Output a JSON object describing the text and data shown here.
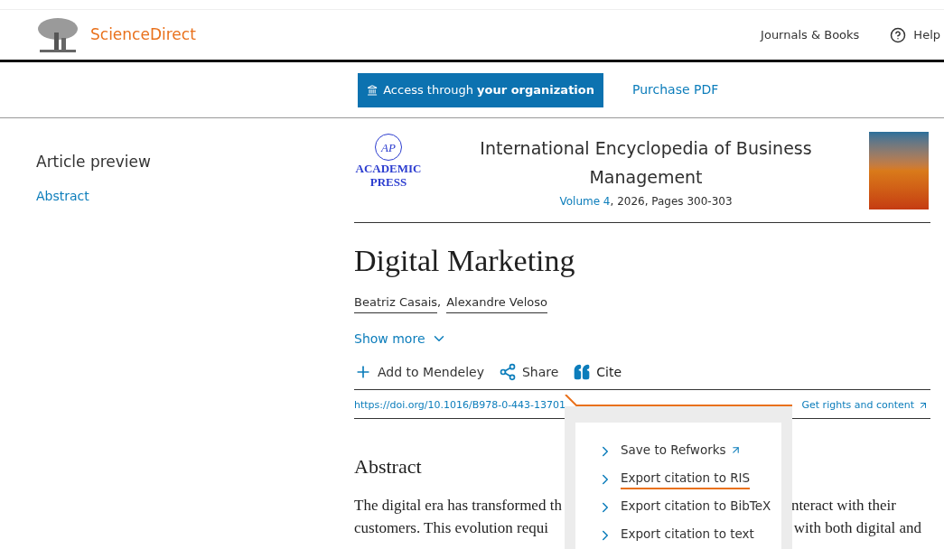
{
  "header": {
    "brand": "ScienceDirect",
    "nav": [
      {
        "label": "Journals & Books",
        "kind": "plain"
      },
      {
        "label": "Help",
        "kind": "help"
      }
    ]
  },
  "access_bar": {
    "primary": {
      "text": "Access through **your organization**"
    },
    "secondary": "Purchase PDF"
  },
  "sidebar": {
    "title": "Article preview",
    "links": [
      "Abstract"
    ]
  },
  "publication": {
    "publisher_mark": "AP",
    "publisher_name": [
      "ACADEMIC",
      "PRESS"
    ],
    "title": "International Encyclopedia of Business Management",
    "volume_link": "Volume 4",
    "details": ", 2026, Pages 300-303"
  },
  "article": {
    "title": "Digital Marketing",
    "authors": [
      "Beatriz Casais",
      "Alexandre Veloso"
    ],
    "author_separator": ",",
    "show_more": "Show more",
    "actions": [
      {
        "label": "Add to Mendeley",
        "selected": false
      },
      {
        "label": "Share",
        "selected": false
      },
      {
        "label": "Cite",
        "selected": true
      }
    ],
    "doi": "https://doi.org/10.1016/B978-0-443-13701",
    "rights": "Get rights and content"
  },
  "cite_menu": {
    "items": [
      {
        "label": "Save to Refworks",
        "external": true,
        "selected": false
      },
      {
        "label": "Export citation to RIS",
        "external": false,
        "selected": true
      },
      {
        "label": "Export citation to BibTeX",
        "external": false,
        "selected": false
      },
      {
        "label": "Export citation to text",
        "external": false,
        "selected": false
      }
    ]
  },
  "abstract": {
    "heading": "Abstract",
    "lines": [
      {
        "left": "The digital era has transformed th",
        "right": "nteract with their"
      },
      {
        "left": "customers. This evolution requi",
        "right": "with both digital and"
      }
    ]
  }
}
